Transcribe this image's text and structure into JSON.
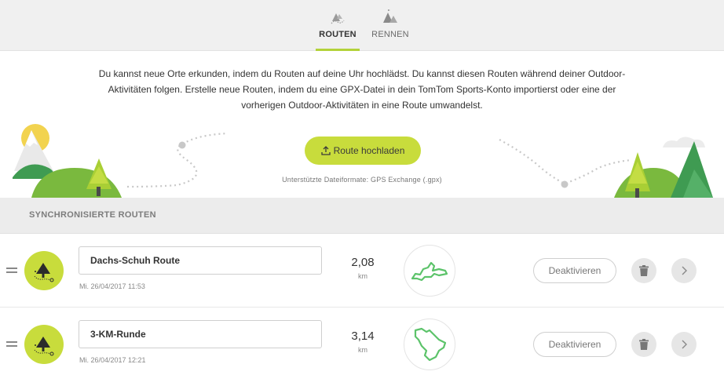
{
  "tabs": {
    "routes": {
      "label": "ROUTEN",
      "active": true
    },
    "races": {
      "label": "RENNEN",
      "active": false
    }
  },
  "intro": {
    "lines": [
      "Du kannst neue Orte erkunden, indem du Routen auf deine Uhr hochlädst. Du kannst diesen Routen während deiner Outdoor-",
      "Aktivitäten folgen. Erstelle neue Routen, indem du eine GPX-Datei in dein TomTom Sports-Konto importierst oder eine der",
      "vorherigen Outdoor-Aktivitäten in eine Route umwandelst."
    ],
    "upload_label": "Route hochladen",
    "upload_icon": "upload-icon",
    "formats": "Unterstützte Dateiformate: GPS Exchange (.gpx)"
  },
  "section": {
    "title": "SYNCHRONISIERTE ROUTEN"
  },
  "routes": [
    {
      "name": "Dachs-Schuh Route",
      "date": "Mi. 26/04/2017 11:53",
      "distance": "2,08",
      "unit": "km",
      "deactivate_label": "Deaktivieren"
    },
    {
      "name": "3-KM-Runde",
      "date": "Mi. 26/04/2017 12:21",
      "distance": "3,14",
      "unit": "km",
      "deactivate_label": "Deaktivieren"
    }
  ],
  "colors": {
    "accent": "#c8dc3c",
    "route_line": "#5cc36a",
    "tree_dark": "#2b2b2b",
    "header_bg": "#ececec"
  }
}
